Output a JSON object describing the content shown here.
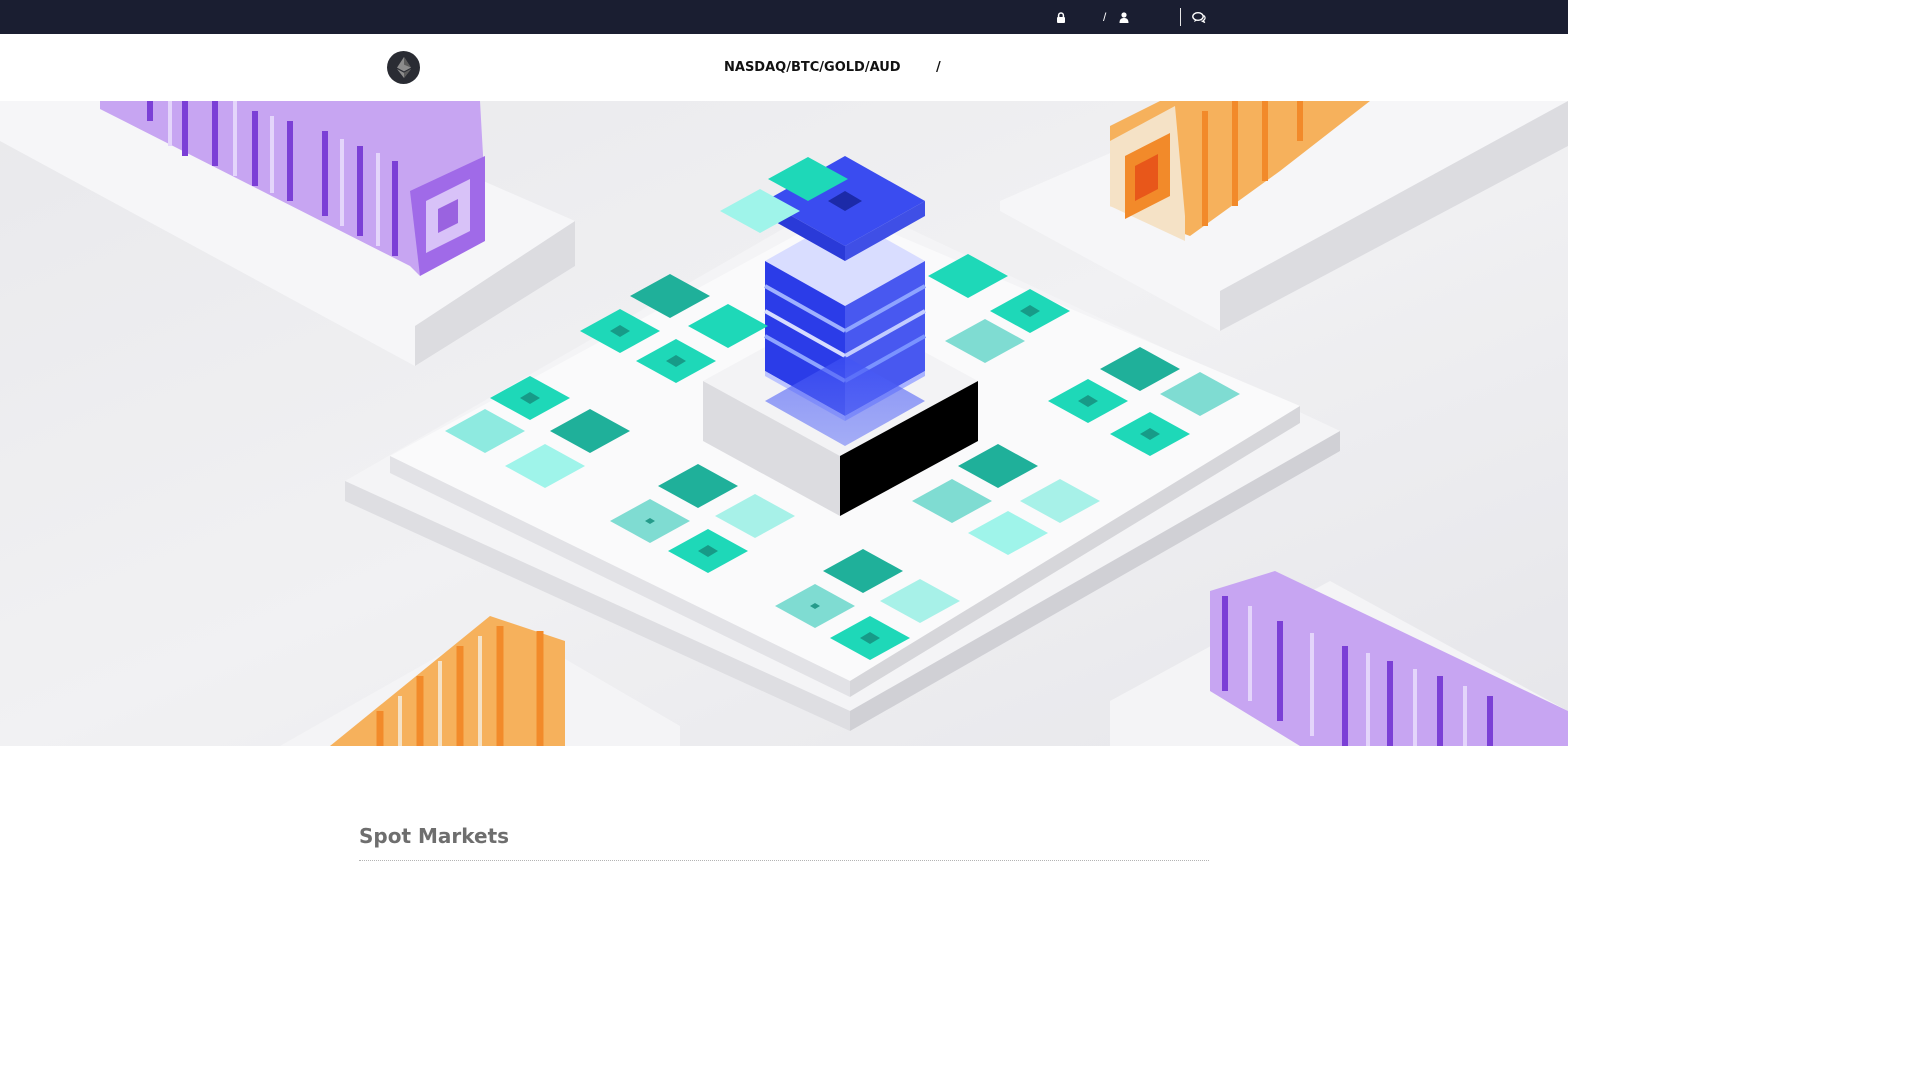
{
  "topbar": {
    "login_icon": "lock-icon",
    "separator": "/",
    "register_icon": "user-icon",
    "chat_icon": "chat-bubble-icon"
  },
  "nav": {
    "logo_icon": "ethereum-logo-icon",
    "markets_label": "NASDAQ/BTC/GOLD/AUD",
    "slash": "/"
  },
  "hero": {
    "image": "isometric-blocks-illustration"
  },
  "spot": {
    "title": "Spot Markets"
  },
  "colors": {
    "topbar_bg": "#1a1e31",
    "teal": "#1ed8b8",
    "blue": "#3a4cf0",
    "purple": "#8a4fe0",
    "orange": "#f28a2a"
  }
}
